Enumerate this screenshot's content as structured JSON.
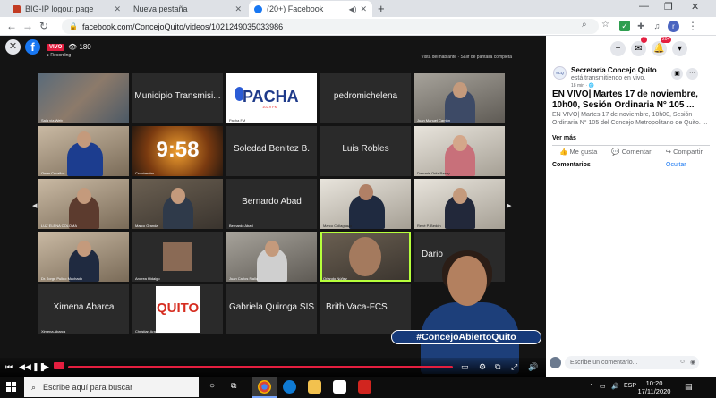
{
  "browser": {
    "tabs": [
      {
        "title": "BIG-IP logout page",
        "active": false
      },
      {
        "title": "Nueva pestaña",
        "active": false
      },
      {
        "title": "(20+) Facebook",
        "active": true
      }
    ],
    "url": "facebook.com/ConcejoQuito/videos/1021249035033986",
    "profile_initial": "r"
  },
  "video": {
    "live_label": "VIVO",
    "viewers": "180",
    "recording_label": "Recording",
    "top_buttons": "Vista del hablante  ·  Salir de pantalla completa",
    "tiles": [
      {
        "label": "",
        "corner": "Sala vía Web"
      },
      {
        "label": "Municipio Transmisi...",
        "corner": ""
      },
      {
        "label": "PACHA",
        "corner": "Pacha FM"
      },
      {
        "label": "pedromichelena",
        "corner": ""
      },
      {
        "label": "",
        "corner": "Juan Manuel Carrión"
      },
      {
        "label": "",
        "corner": "Omar Cevallos"
      },
      {
        "label": "9:58",
        "corner": "Cronómetro"
      },
      {
        "label": "Soledad Benitez B.",
        "corner": ""
      },
      {
        "label": "Luis Robles",
        "corner": ""
      },
      {
        "label": "",
        "corner": "Damaris Ortiz Pasuy"
      },
      {
        "label": "",
        "corner": "LUZ ELENA COLOMA"
      },
      {
        "label": "",
        "corner": "Marco Granda"
      },
      {
        "label": "Bernardo Abad",
        "corner": "Bernardo Abad"
      },
      {
        "label": "",
        "corner": "Marco Collaguazo"
      },
      {
        "label": "",
        "corner": "René P. Bedón"
      },
      {
        "label": "",
        "corner": "Dr. Jorge Pulido Machado"
      },
      {
        "label": "",
        "corner": "Andrea Hidalgo"
      },
      {
        "label": "",
        "corner": "Juan Carlos Fiallo"
      },
      {
        "label": "",
        "corner": "Orlando Núñez"
      },
      {
        "label": "Dario",
        "corner": ""
      },
      {
        "label": "Ximena Abarca",
        "corner": "Ximena Abarca"
      },
      {
        "label": "QUITO",
        "corner": "Christian Arana"
      },
      {
        "label": "Gabriela Quiroga SIS",
        "corner": ""
      },
      {
        "label": "Brith Vaca-FCS",
        "corner": ""
      }
    ],
    "hashtag": "#ConcejoAbiertoQuito"
  },
  "fb_header": {
    "messenger_badge": "7",
    "notif_badge": "20+"
  },
  "post": {
    "page_name": "Secretaría Concejo Quito",
    "status": "está transmitiendo en vivo.",
    "time": "18 min · 🌐",
    "title": "EN VIVO| Martes 17 de noviembre, 10h00, Sesión Ordinaria N° 105 ...",
    "description": "EN VIVO| Martes 17 de noviembre, 10h00, Sesión Ordinaria N° 105 del Concejo Metropolitano de Quito. ...",
    "see_more": "Ver más",
    "actions": {
      "like": "Me gusta",
      "comment": "Comentar",
      "share": "Compartir"
    },
    "comments_label": "Comentarios",
    "hide_label": "Ocultar",
    "comment_placeholder": "Escribe un comentario..."
  },
  "taskbar": {
    "search_placeholder": "Escribe aquí para buscar",
    "language": "ESP",
    "time": "10:20",
    "date": "17/11/2020"
  }
}
